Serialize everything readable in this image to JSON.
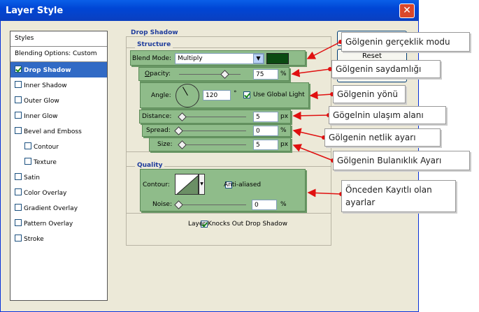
{
  "window": {
    "title": "Layer Style",
    "close_glyph": "✕"
  },
  "styles_list": {
    "items": [
      {
        "label": "Styles",
        "checkbox": false,
        "checked": false,
        "selected": false,
        "indent": false
      },
      {
        "label": "Blending Options: Custom",
        "checkbox": false,
        "checked": false,
        "selected": false,
        "indent": false
      },
      {
        "label": "Drop Shadow",
        "checkbox": true,
        "checked": true,
        "selected": true,
        "indent": false
      },
      {
        "label": "Inner Shadow",
        "checkbox": true,
        "checked": false,
        "selected": false,
        "indent": false
      },
      {
        "label": "Outer Glow",
        "checkbox": true,
        "checked": false,
        "selected": false,
        "indent": false
      },
      {
        "label": "Inner Glow",
        "checkbox": true,
        "checked": false,
        "selected": false,
        "indent": false
      },
      {
        "label": "Bevel and Emboss",
        "checkbox": true,
        "checked": false,
        "selected": false,
        "indent": false
      },
      {
        "label": "Contour",
        "checkbox": true,
        "checked": false,
        "selected": false,
        "indent": true
      },
      {
        "label": "Texture",
        "checkbox": true,
        "checked": false,
        "selected": false,
        "indent": true
      },
      {
        "label": "Satin",
        "checkbox": true,
        "checked": false,
        "selected": false,
        "indent": false
      },
      {
        "label": "Color Overlay",
        "checkbox": true,
        "checked": false,
        "selected": false,
        "indent": false
      },
      {
        "label": "Gradient Overlay",
        "checkbox": true,
        "checked": false,
        "selected": false,
        "indent": false
      },
      {
        "label": "Pattern Overlay",
        "checkbox": true,
        "checked": false,
        "selected": false,
        "indent": false
      },
      {
        "label": "Stroke",
        "checkbox": true,
        "checked": false,
        "selected": false,
        "indent": false
      }
    ]
  },
  "drop_shadow": {
    "title": "Drop Shadow",
    "structure": {
      "title": "Structure",
      "blend_mode_label": "Blend Mode:",
      "blend_mode_value": "Multiply",
      "shadow_color": "#0b4a12",
      "opacity_label": "Opacity:",
      "opacity_value": "75",
      "opacity_unit": "%",
      "angle_label": "Angle:",
      "angle_value": "120",
      "angle_unit": "°",
      "use_global_light_label": "Use Global Light",
      "use_global_light_checked": true,
      "distance_label": "Distance:",
      "distance_value": "5",
      "distance_unit": "px",
      "spread_label": "Spread:",
      "spread_value": "0",
      "spread_unit": "%",
      "size_label": "Size:",
      "size_value": "5",
      "size_unit": "px"
    },
    "quality": {
      "title": "Quality",
      "contour_label": "Contour:",
      "anti_aliased_label": "Anti-aliased",
      "anti_aliased_checked": false,
      "noise_label": "Noise:",
      "noise_value": "0",
      "noise_unit": "%"
    },
    "knocks_out_label": "Layer Knocks Out Drop Shadow",
    "knocks_out_checked": true
  },
  "buttons": {
    "reset_label": "Reset"
  },
  "callouts": {
    "blend_mode": "Gölgenin gerçeklik modu",
    "opacity": "Gölgenin saydamlığı",
    "angle": "Gölgenin yönü",
    "distance": "Gögelnin ulaşım alanı",
    "spread": "Gölgenin netlik ayarı",
    "size": "Gölgenin Bulanıklık Ayarı",
    "quality": "Önceden Kayıtlı olan ayarlar"
  },
  "colors": {
    "accent": "#316ac5",
    "panel_green": "#8fbc8a",
    "arrow_red": "#e01010",
    "title_blue": "#1e3c9c"
  }
}
